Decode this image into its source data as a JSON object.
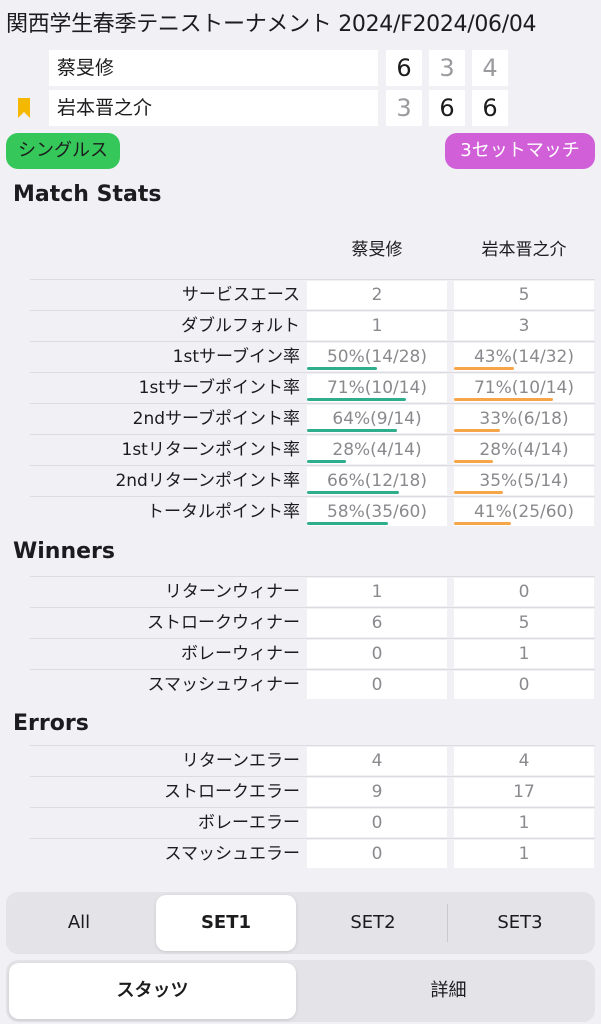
{
  "header": {
    "title": "関西学生春季テニストーナメント 2024/F2024/06/04"
  },
  "players": [
    {
      "name": "蔡旻修",
      "bookmarked": false,
      "sets": [
        {
          "score": "6",
          "won": true
        },
        {
          "score": "3",
          "won": false
        },
        {
          "score": "4",
          "won": false
        }
      ]
    },
    {
      "name": "岩本晋之介",
      "bookmarked": true,
      "sets": [
        {
          "score": "3",
          "won": false
        },
        {
          "score": "6",
          "won": true
        },
        {
          "score": "6",
          "won": true
        }
      ]
    }
  ],
  "tags": {
    "format": "シングルス",
    "match_type": "3セットマッチ"
  },
  "colors": {
    "format_tag": "#35c759",
    "match_type_tag": "#d160d8",
    "player_a_bar": "#2fae8e",
    "player_b_bar": "#f6a548",
    "bookmark": "#f5b800"
  },
  "match_stats": {
    "title": "Match Stats",
    "player_a": "蔡旻修",
    "player_b": "岩本晋之介",
    "rows": [
      {
        "label": "サービスエース",
        "a": "2",
        "b": "5"
      },
      {
        "label": "ダブルフォルト",
        "a": "1",
        "b": "3"
      },
      {
        "label": "1stサーブイン率",
        "a": "50%(14/28)",
        "b": "43%(14/32)",
        "a_pct": 50,
        "b_pct": 43
      },
      {
        "label": "1stサーブポイント率",
        "a": "71%(10/14)",
        "b": "71%(10/14)",
        "a_pct": 71,
        "b_pct": 71
      },
      {
        "label": "2ndサーブポイント率",
        "a": "64%(9/14)",
        "b": "33%(6/18)",
        "a_pct": 64,
        "b_pct": 33
      },
      {
        "label": "1stリターンポイント率",
        "a": "28%(4/14)",
        "b": "28%(4/14)",
        "a_pct": 28,
        "b_pct": 28
      },
      {
        "label": "2ndリターンポイント率",
        "a": "66%(12/18)",
        "b": "35%(5/14)",
        "a_pct": 66,
        "b_pct": 35
      },
      {
        "label": "トータルポイント率",
        "a": "58%(35/60)",
        "b": "41%(25/60)",
        "a_pct": 58,
        "b_pct": 41
      }
    ]
  },
  "winners": {
    "title": "Winners",
    "rows": [
      {
        "label": "リターンウィナー",
        "a": "1",
        "b": "0"
      },
      {
        "label": "ストロークウィナー",
        "a": "6",
        "b": "5"
      },
      {
        "label": "ボレーウィナー",
        "a": "0",
        "b": "1"
      },
      {
        "label": "スマッシュウィナー",
        "a": "0",
        "b": "0"
      }
    ]
  },
  "errors": {
    "title": "Errors",
    "rows": [
      {
        "label": "リターンエラー",
        "a": "4",
        "b": "4"
      },
      {
        "label": "ストロークエラー",
        "a": "9",
        "b": "17"
      },
      {
        "label": "ボレーエラー",
        "a": "0",
        "b": "1"
      },
      {
        "label": "スマッシュエラー",
        "a": "0",
        "b": "1"
      }
    ]
  },
  "set_tabs": {
    "items": [
      "All",
      "SET1",
      "SET2",
      "SET3"
    ],
    "selected": "SET1"
  },
  "view_tabs": {
    "items": [
      "スタッツ",
      "詳細"
    ],
    "selected": "スタッツ"
  }
}
